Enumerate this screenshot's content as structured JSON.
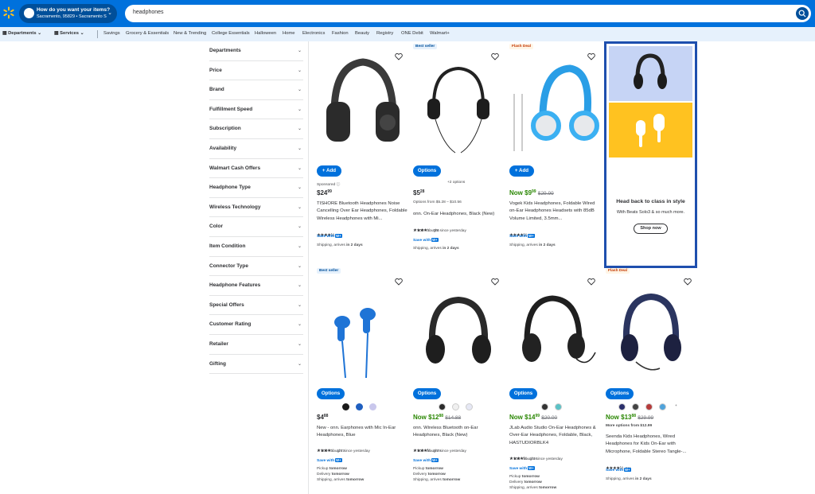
{
  "header": {
    "ship_prompt": "How do you want your items?",
    "ship_location": "Sacramento, 95829 • Sacramento Su...",
    "search_value": "headphones"
  },
  "nav": {
    "departments": "Departments",
    "services": "Services",
    "links": [
      "Savings",
      "Grocery & Essentials",
      "New & Trending",
      "College Essentials",
      "Halloween",
      "Home",
      "Electronics",
      "Fashion",
      "Beauty",
      "Registry",
      "ONE Debit",
      "Walmart+"
    ]
  },
  "filters": [
    "Departments",
    "Price",
    "Brand",
    "Fulfillment Speed",
    "Subscription",
    "Availability",
    "Walmart Cash Offers",
    "Headphone Type",
    "Wireless Technology",
    "Color",
    "Item Condition",
    "Connector Type",
    "Headphone Features",
    "Special Offers",
    "Customer Rating",
    "Retailer",
    "Gifting"
  ],
  "products": {
    "p1": {
      "button": "+ Add",
      "sponsored": "Sponsored",
      "price_main": "$24",
      "price_cents": "99",
      "title": "TISHORE Bluetooth Headphones Noise Cancelling Over Ear Headphones, Foldable Wireless Headphones with Mi...",
      "stars": "★★★★½",
      "reviews": "621",
      "save": "Save with",
      "fulfillment": "Shipping, arrives",
      "fulfillment_day": "in 2 days",
      "stars_value": 4.5
    },
    "p2": {
      "badge": "Best seller",
      "button": "Options",
      "more_options": "+2 options",
      "price_main": "$5",
      "price_cents": "28",
      "options_from": "Options from $5.28 – $10.56",
      "title": "onn. On-Ear Headphones, Black (New)",
      "stars": "★★★★☆",
      "reviews": "785",
      "bought": "100+ bought since yesterday",
      "save": "Save with",
      "fulfillment": "Shipping, arrives",
      "fulfillment_day": "in 2 days",
      "stars_value": 4
    },
    "p3": {
      "badge": "Flash Deal",
      "button": "+ Add",
      "now": "Now",
      "price_main": "$9",
      "price_cents": "99",
      "was": "$29.99",
      "title": "Vogek Kids Headphones, Foldable Wired on-Ear Headphones Headsets with 85dB Volume Limited, 3.5mm...",
      "stars": "★★★★½",
      "reviews": "756",
      "save": "Save with",
      "fulfillment": "Shipping, arrives",
      "fulfillment_day": "in 2 days",
      "stars_value": 4.5
    },
    "p4": {
      "badge": "Best seller",
      "button": "Options",
      "price_main": "$4",
      "price_cents": "88",
      "title": "New - onn. Earphones with Mic In-Ear Headphones, Blue",
      "stars": "★★★★☆",
      "reviews": "1272",
      "bought": "100+ bought since yesterday",
      "save": "Save with",
      "pickup": "Pickup",
      "pickup_day": "tomorrow",
      "delivery": "Delivery",
      "delivery_day": "tomorrow",
      "shipping": "Shipping, arrives",
      "shipping_day": "tomorrow",
      "stars_value": 4
    },
    "p5": {
      "button": "Options",
      "now": "Now",
      "price_main": "$12",
      "price_cents": "88",
      "was": "$14.88",
      "title": "onn. Wireless Bluetooth on-Ear Headphones, Black (New)",
      "stars": "★★★★½",
      "reviews": "2879",
      "bought": "100+ bought since yesterday",
      "save": "Save with",
      "pickup": "Pickup",
      "pickup_day": "tomorrow",
      "delivery": "Delivery",
      "delivery_day": "tomorrow",
      "shipping": "Shipping, arrives",
      "shipping_day": "tomorrow",
      "stars_value": 4.5
    },
    "p6": {
      "button": "Options",
      "now": "Now",
      "price_main": "$14",
      "price_cents": "99",
      "was": "$20.00",
      "title": "JLab Audio Studio On-Ear Headphones & Over-Ear Headphones, Foldable, Black, HASTUDIORBLK4",
      "stars": "★★★★½",
      "reviews": "1306",
      "bought": "100+ bought since yesterday",
      "save": "Save with",
      "pickup": "Pickup",
      "pickup_day": "tomorrow",
      "delivery": "Delivery",
      "delivery_day": "tomorrow",
      "shipping": "Shipping, arrives",
      "shipping_day": "tomorrow",
      "stars_value": 4.5
    },
    "p7": {
      "badge": "Flash Deal",
      "button": "Options",
      "more": "+",
      "now": "Now",
      "price_main": "$13",
      "price_cents": "88",
      "was": "$29.99",
      "options_from": "More options from $12.99",
      "title": "Seenda Kids Headphones, Wired Headphones for Kids On-Ear with Microphone, Foldable Stereo Tangle-...",
      "stars": "★★★★½",
      "reviews": "811",
      "save": "Save with",
      "fulfillment": "Shipping, arrives",
      "fulfillment_day": "in 2 days",
      "stars_value": 4.5
    }
  },
  "wplus": "W+",
  "ad": {
    "headline": "Head back to class in style",
    "sub": "With Beats Solo3 & so much more.",
    "button": "Shop now"
  },
  "colors": {
    "brand_blue": "#0071dc",
    "spark_yellow": "#ffc220",
    "now_green": "#2a8703",
    "dark_navy": "#004f9a"
  }
}
